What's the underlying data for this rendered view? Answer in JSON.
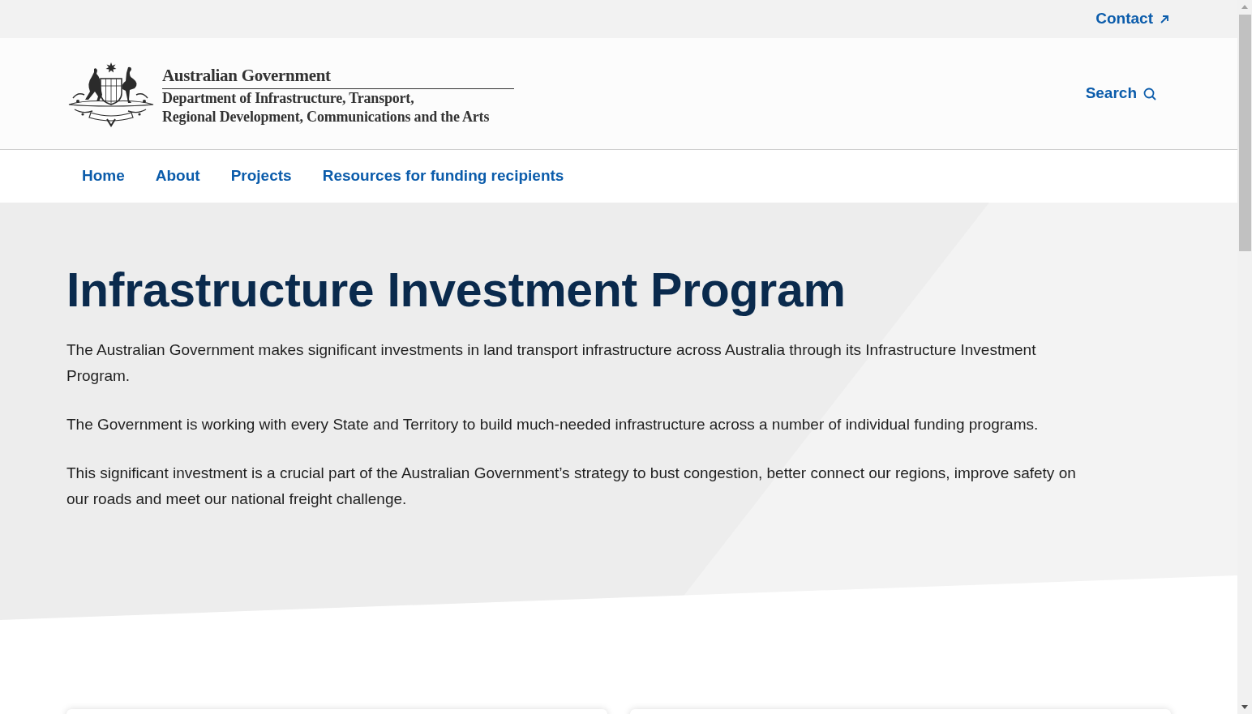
{
  "top_bar": {
    "contact_link": "Contact"
  },
  "header": {
    "government": "Australian Government",
    "department_lines": [
      "Department of Infrastructure, Transport,",
      "Regional Development, Communications and the Arts"
    ],
    "search_button": "Search"
  },
  "nav": {
    "items": [
      {
        "label": "Home"
      },
      {
        "label": "About"
      },
      {
        "label": "Projects"
      },
      {
        "label": "Resources for funding recipients"
      }
    ]
  },
  "hero": {
    "title": "Infrastructure Investment Program",
    "paragraphs": [
      "The Australian Government makes significant investments in land transport infrastructure across Australia through its Infrastructure Investment Program.",
      "The Government is working with every State and Territory to build much-needed infrastructure across a number of individual funding programs.",
      "This significant investment is a crucial part of the Australian Government’s strategy to bust congestion, better connect our regions, improve safety on our roads and meet our national freight challenge."
    ]
  }
}
